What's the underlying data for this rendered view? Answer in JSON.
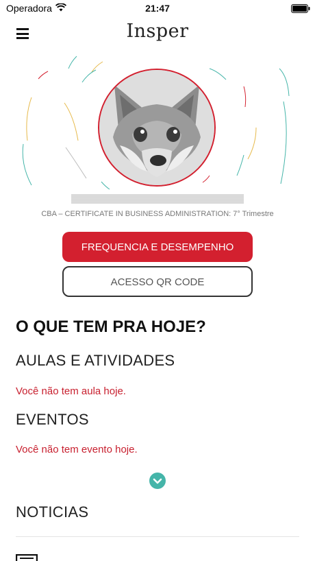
{
  "status_bar": {
    "carrier": "Operadora",
    "time": "21:47"
  },
  "nav": {
    "logo": "Insper"
  },
  "profile": {
    "course": "CBA – CERTIFICATE IN BUSINESS ADMINISTRATION: 7° Trimestre"
  },
  "actions": {
    "primary_label": "FREQUENCIA E DESEMPENHO",
    "secondary_label": "ACESSO QR CODE"
  },
  "today": {
    "heading": "O QUE TEM PRA HOJE?",
    "classes_title": "AULAS E ATIVIDADES",
    "classes_empty": "Você não tem aula hoje.",
    "events_title": "EVENTOS",
    "events_empty": "Você não tem evento hoje.",
    "news_title": "NOTICIAS"
  },
  "colors": {
    "brand_red": "#d3202f",
    "accent_teal": "#45b5a9"
  }
}
